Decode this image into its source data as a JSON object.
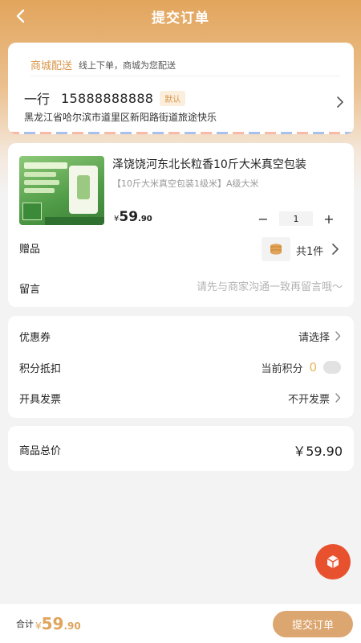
{
  "nav": {
    "title": "提交订单"
  },
  "address": {
    "delivery_label": "商城配送",
    "delivery_hint": "线上下单，商城为您配送",
    "name": "一行",
    "phone": "15888888888",
    "default_badge": "默认",
    "detail": "黑龙江省哈尔滨市道里区新阳路街道旅途快乐"
  },
  "product": {
    "name": "泽饶饶河东北长粒香10斤大米真空包装",
    "spec": "【10斤大米真空包装1级米】A级大米",
    "price_currency": "¥",
    "price_int": "59",
    "price_dec": ".90",
    "quantity": "1",
    "stepper_minus": "−",
    "stepper_plus": "+"
  },
  "gift": {
    "label": "赠品",
    "count": "共1件"
  },
  "message": {
    "label": "留言",
    "placeholder": "请先与商家沟通一致再留言哦～"
  },
  "options": {
    "coupon_label": "优惠券",
    "coupon_value": "请选择",
    "points_label": "积分抵扣",
    "points_text": "当前积分",
    "points_value": "0",
    "invoice_label": "开具发票",
    "invoice_value": "不开发票"
  },
  "total": {
    "label": "商品总价",
    "amount": "￥59.90"
  },
  "bottom": {
    "sum_label": "合计",
    "currency": "¥",
    "int": "59",
    "dec": ".90",
    "submit_label": "提交订单"
  },
  "colors": {
    "accent": "#e0a45c",
    "float_button": "#e8512e",
    "submit_bg": "#dca670"
  }
}
